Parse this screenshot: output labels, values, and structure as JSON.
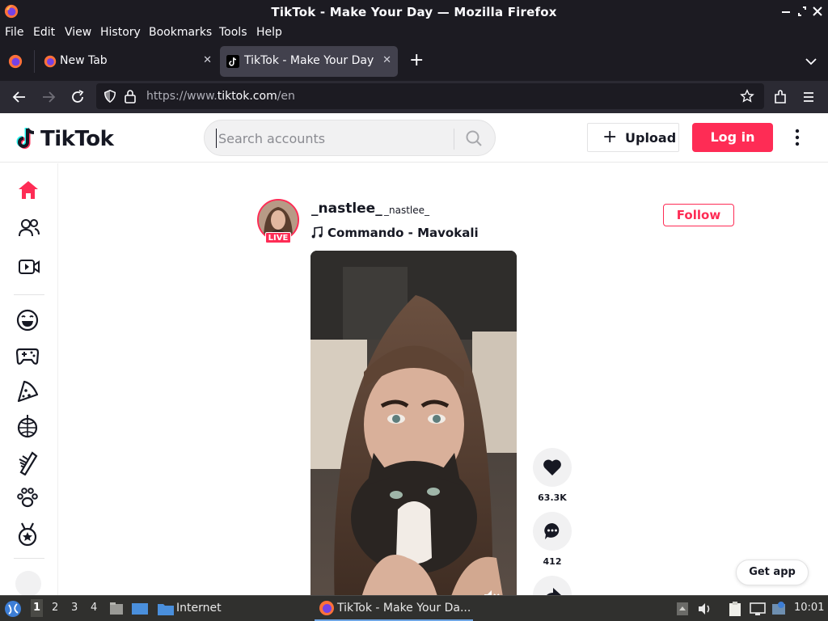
{
  "window": {
    "title": "TikTok - Make Your Day — Mozilla Firefox"
  },
  "menubar": {
    "items": [
      "File",
      "Edit",
      "View",
      "History",
      "Bookmarks",
      "Tools",
      "Help"
    ]
  },
  "tabs": [
    {
      "label": "New Tab",
      "close": "✕"
    },
    {
      "label": "TikTok - Make Your Day",
      "close": "✕",
      "active": true
    }
  ],
  "newtab_button": "+",
  "urlbar": {
    "prefix": "https://www.",
    "domain": "tiktok.com",
    "path": "/en"
  },
  "tiktok": {
    "logo_text": "TikTok",
    "search_placeholder": "Search accounts",
    "upload_label": "Upload",
    "upload_plus": "+",
    "login_label": "Log in",
    "post": {
      "author": "_nastlee_",
      "nickname": "_nastlee_",
      "live_badge": "LIVE",
      "music": "Commando - Mavokali",
      "follow_label": "Follow",
      "likes": "63.3K",
      "comments": "412"
    },
    "get_app_label": "Get app"
  },
  "taskbar": {
    "workspaces": [
      "1",
      "2",
      "3",
      "4"
    ],
    "launcher_label": "Internet",
    "task_label": "TikTok - Make Your Da...",
    "clock": "10:01"
  },
  "colors": {
    "tiktok_red": "#fe2c55",
    "firefox_dark": "#1c1b22",
    "taskbar": "#30302e"
  }
}
